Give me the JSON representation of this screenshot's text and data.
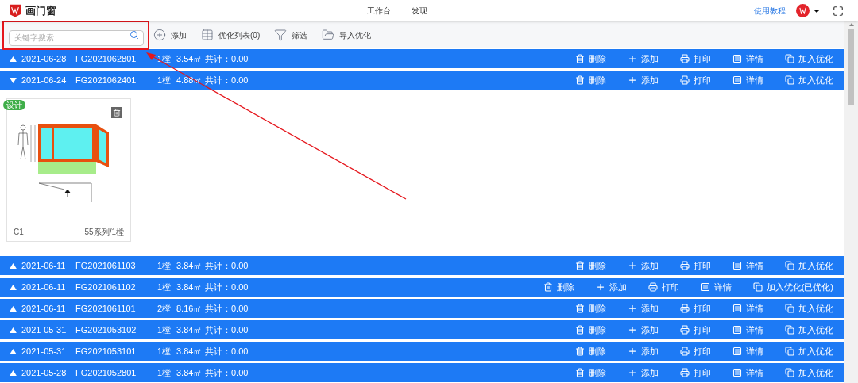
{
  "header": {
    "brand": "画门窗",
    "nav": [
      {
        "label": "工作台"
      },
      {
        "label": "发现"
      }
    ],
    "help_link": "使用教程"
  },
  "toolbar": {
    "search": {
      "placeholder": "关键字搜索"
    },
    "actions": [
      {
        "kind": "add",
        "label": "添加"
      },
      {
        "kind": "list",
        "label": "优化列表(0)"
      },
      {
        "kind": "filter",
        "label": "筛选"
      },
      {
        "kind": "folder",
        "label": "导入优化"
      }
    ]
  },
  "orders": [
    {
      "date": "2021-06-28",
      "code": "FG2021062801",
      "count": "1樘",
      "area": "3.54㎡",
      "total": "共计：0.00",
      "expanded": false,
      "actions": [
        {
          "kind": "delete",
          "label": "删除"
        },
        {
          "kind": "add",
          "label": "添加"
        },
        {
          "kind": "print",
          "label": "打印"
        },
        {
          "kind": "detail",
          "label": "详情"
        },
        {
          "kind": "optimize",
          "label": "加入优化"
        }
      ]
    },
    {
      "date": "2021-06-24",
      "code": "FG2021062401",
      "count": "1樘",
      "area": "4.88㎡",
      "total": "共计：0.00",
      "expanded": true,
      "actions": [
        {
          "kind": "delete",
          "label": "删除"
        },
        {
          "kind": "add",
          "label": "添加"
        },
        {
          "kind": "print",
          "label": "打印"
        },
        {
          "kind": "detail",
          "label": "详情"
        },
        {
          "kind": "optimize",
          "label": "加入优化"
        }
      ],
      "items": [
        {
          "badge": "设计",
          "name": "C1",
          "spec": "55系列/1樘"
        }
      ]
    },
    {
      "date": "2021-06-11",
      "code": "FG2021061103",
      "count": "1樘",
      "area": "3.84㎡",
      "total": "共计：0.00",
      "expanded": false,
      "actions": [
        {
          "kind": "delete",
          "label": "删除"
        },
        {
          "kind": "add",
          "label": "添加"
        },
        {
          "kind": "print",
          "label": "打印"
        },
        {
          "kind": "detail",
          "label": "详情"
        },
        {
          "kind": "optimize",
          "label": "加入优化"
        }
      ]
    },
    {
      "date": "2021-06-11",
      "code": "FG2021061102",
      "count": "1樘",
      "area": "3.84㎡",
      "total": "共计：0.00",
      "expanded": false,
      "actions": [
        {
          "kind": "delete",
          "label": "删除"
        },
        {
          "kind": "add",
          "label": "添加"
        },
        {
          "kind": "print",
          "label": "打印"
        },
        {
          "kind": "detail",
          "label": "详情"
        },
        {
          "kind": "optimize",
          "label": "加入优化(已优化)"
        }
      ]
    },
    {
      "date": "2021-06-11",
      "code": "FG2021061101",
      "count": "2樘",
      "area": "8.16㎡",
      "total": "共计：0.00",
      "expanded": false,
      "actions": [
        {
          "kind": "delete",
          "label": "删除"
        },
        {
          "kind": "add",
          "label": "添加"
        },
        {
          "kind": "print",
          "label": "打印"
        },
        {
          "kind": "detail",
          "label": "详情"
        },
        {
          "kind": "optimize",
          "label": "加入优化"
        }
      ]
    },
    {
      "date": "2021-05-31",
      "code": "FG2021053102",
      "count": "1樘",
      "area": "3.84㎡",
      "total": "共计：0.00",
      "expanded": false,
      "actions": [
        {
          "kind": "delete",
          "label": "删除"
        },
        {
          "kind": "add",
          "label": "添加"
        },
        {
          "kind": "print",
          "label": "打印"
        },
        {
          "kind": "detail",
          "label": "详情"
        },
        {
          "kind": "optimize",
          "label": "加入优化"
        }
      ]
    },
    {
      "date": "2021-05-31",
      "code": "FG2021053101",
      "count": "1樘",
      "area": "3.84㎡",
      "total": "共计：0.00",
      "expanded": false,
      "actions": [
        {
          "kind": "delete",
          "label": "删除"
        },
        {
          "kind": "add",
          "label": "添加"
        },
        {
          "kind": "print",
          "label": "打印"
        },
        {
          "kind": "detail",
          "label": "详情"
        },
        {
          "kind": "optimize",
          "label": "加入优化"
        }
      ]
    },
    {
      "date": "2021-05-28",
      "code": "FG2021052801",
      "count": "1樘",
      "area": "3.84㎡",
      "total": "共计：0.00",
      "expanded": false,
      "actions": [
        {
          "kind": "delete",
          "label": "删除"
        },
        {
          "kind": "add",
          "label": "添加"
        },
        {
          "kind": "print",
          "label": "打印"
        },
        {
          "kind": "detail",
          "label": "详情"
        },
        {
          "kind": "optimize",
          "label": "加入优化"
        }
      ]
    }
  ]
}
